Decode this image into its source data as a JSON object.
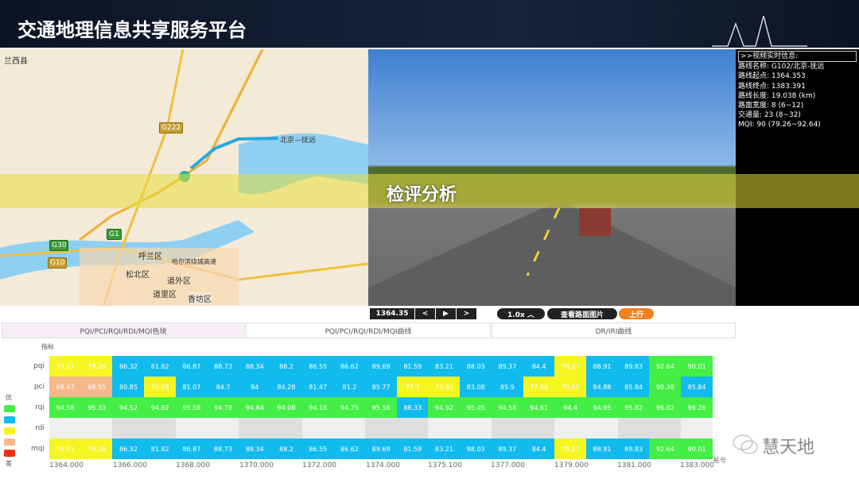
{
  "header": {
    "title": "交通地理信息共享服务平台"
  },
  "map": {
    "labels": [
      "兰西县",
      "呼兰区",
      "松北区",
      "道外区",
      "道里区",
      "香坊区",
      "北京—抚远",
      "哈尔滨绕城高速",
      "G30",
      "G10",
      "G222",
      "G1"
    ]
  },
  "overlay": {
    "title": "检评分析"
  },
  "info": {
    "header": ">>视频实时信息:",
    "lines": [
      "路线名称: G102/北京-抚远",
      "路线起点: 1364.353",
      "路线终点: 1383.391",
      "路线长度: 19.038 (km)",
      "路面宽度: 8 (6~12)",
      "交通量: 23 (8~32)",
      "MQI: 90 (79.26~92.64)"
    ]
  },
  "controls": {
    "position": "1364.35",
    "prev": "<",
    "play": "▶",
    "next": ">",
    "speed": "1.0x ︿",
    "view_images": "查看路面图片",
    "direction": "上行"
  },
  "tabs": [
    "PQI/PCI/RQI/RDI/MQI色块",
    "PQI/PCI/RQI/RDI/MQI曲线",
    "DR/IRI曲线"
  ],
  "colors": {
    "green": "#44ee44",
    "blue": "#11bbee",
    "yellow": "#f5f522",
    "orange": "#f5b88a",
    "red": "#ee3311",
    "gray": "#e8e8e8",
    "accent": "#f08020"
  },
  "chart_data": {
    "type": "heatmap",
    "ylabel": "指标",
    "xlabel": "桩号",
    "rows": [
      "pqi",
      "pci",
      "rqi",
      "rdi",
      "mqi"
    ],
    "xticks": [
      "1364.000",
      "1366.000",
      "1368.000",
      "1370.000",
      "1372.000",
      "1374.000",
      "1375.100",
      "1377.000",
      "1379.000",
      "1381.000",
      "1383.000"
    ],
    "legend": {
      "top": "优",
      "bottom": "差",
      "levels": [
        "green",
        "blue",
        "yellow",
        "orange",
        "red"
      ]
    },
    "values": {
      "pqi": [
        "79.51",
        "79.26",
        "86.32",
        "81.82",
        "86.87",
        "88.73",
        "88.34",
        "88.2",
        "86.55",
        "86.62",
        "89.69",
        "81.59",
        "83.21",
        "88.03",
        "89.37",
        "84.4",
        "79.27",
        "88.91",
        "89.83",
        "92.64",
        "90.01"
      ],
      "pci": [
        "68.47",
        "68.55",
        "80.85",
        "75.08",
        "81.07",
        "84.7",
        "84",
        "84.28",
        "81.47",
        "81.2",
        "85.77",
        "77.1",
        "73.41",
        "83.08",
        "85.9",
        "77.08",
        "70.02",
        "84.88",
        "85.84",
        "90.38",
        "85.84"
      ],
      "rqi": [
        "94.58",
        "95.33",
        "94.52",
        "94.92",
        "95.58",
        "94.78",
        "94.84",
        "94.08",
        "94.18",
        "94.75",
        "95.58",
        "88.33",
        "94.92",
        "95.45",
        "94.58",
        "94.61",
        "94.4",
        "94.95",
        "95.82",
        "96.02",
        "96.26"
      ],
      "rdi": [],
      "mqi": [
        "79.51",
        "79.26",
        "86.32",
        "81.82",
        "86.87",
        "88.73",
        "88.34",
        "88.2",
        "86.55",
        "86.62",
        "89.69",
        "81.59",
        "83.21",
        "88.03",
        "89.37",
        "84.4",
        "79.27",
        "88.91",
        "89.83",
        "92.64",
        "90.01"
      ]
    },
    "levels": {
      "pqi": [
        "yellow",
        "yellow",
        "blue",
        "blue",
        "blue",
        "blue",
        "blue",
        "blue",
        "blue",
        "blue",
        "blue",
        "blue",
        "blue",
        "blue",
        "blue",
        "blue",
        "yellow",
        "blue",
        "blue",
        "green",
        "green"
      ],
      "pci": [
        "orange",
        "orange",
        "blue",
        "yellow",
        "blue",
        "blue",
        "blue",
        "blue",
        "blue",
        "blue",
        "blue",
        "yellow",
        "yellow",
        "blue",
        "blue",
        "yellow",
        "yellow",
        "blue",
        "blue",
        "green",
        "blue"
      ],
      "rqi": [
        "green",
        "green",
        "green",
        "green",
        "green",
        "green",
        "green",
        "green",
        "green",
        "green",
        "green",
        "blue",
        "green",
        "green",
        "green",
        "green",
        "green",
        "green",
        "green",
        "green",
        "green"
      ],
      "mqi": [
        "yellow",
        "yellow",
        "blue",
        "blue",
        "blue",
        "blue",
        "blue",
        "blue",
        "blue",
        "blue",
        "blue",
        "blue",
        "blue",
        "blue",
        "blue",
        "blue",
        "yellow",
        "blue",
        "blue",
        "green",
        "green"
      ]
    }
  },
  "watermark": "慧天地"
}
